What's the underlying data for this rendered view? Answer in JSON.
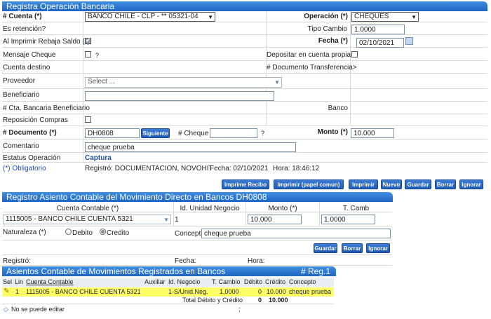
{
  "main_title": "Registra Operación Bancaria",
  "cuenta": {
    "label": "# Cuenta (*)",
    "value": "BANCO CHILE - CLP - ** 05321-04"
  },
  "operacion": {
    "label": "Operación (*)",
    "value": "CHEQUES"
  },
  "retencion": {
    "label": "Es retención?"
  },
  "tipo_cambio": {
    "label": "Tipo Cambio",
    "value": "1.0000"
  },
  "rebaja_saldo": {
    "label": "Al Imprimir Rebaja Saldo (*)"
  },
  "fecha": {
    "label": "Fecha (*)",
    "value": "02/10/2021"
  },
  "mensaje_cheque": {
    "label": "Mensaje Cheque",
    "help": "?"
  },
  "depositar": {
    "label": "Depositar en cuenta propia"
  },
  "cuenta_destino": {
    "label": "Cuenta destino"
  },
  "doc_transferencia": {
    "label": "# Documento Transferencia>"
  },
  "proveedor": {
    "label": "Proveedor",
    "placeholder": "Select ..."
  },
  "beneficiario": {
    "label": "Beneficiario"
  },
  "cta_bancaria": {
    "label": "# Cta. Bancaria Beneficiario"
  },
  "banco": {
    "label": "Banco"
  },
  "reposicion": {
    "label": "Reposición Compras"
  },
  "documento": {
    "label": "# Documento (*)",
    "value": "DH0808",
    "next": "Siguiente"
  },
  "cheque": {
    "label": "# Cheque",
    "help": "?"
  },
  "monto": {
    "label": "Monto (*)",
    "value": "10.000"
  },
  "comentario": {
    "label": "Comentario",
    "value": "cheque prueba"
  },
  "estatus": {
    "label": "Estatus Operación",
    "value": "Captura"
  },
  "footer": {
    "obligatorio": "(*) Obligatorio",
    "registro": "Registró: DOCUMENTACION, NOVOHIT",
    "fecha": "Fecha: 02/10/2021",
    "hora": "Hora: 18:46:12"
  },
  "toolbar": {
    "imprime_recibo": "Imprime Recibo",
    "imprimir_papel": "Imprimir (papel comun)",
    "imprimir": "Imprimir",
    "nuevo": "Nuevo",
    "guardar": "Guardar",
    "borrar": "Borrar",
    "ignorar": "Ignorar"
  },
  "asiento": {
    "title": "Registro Asiento Contable del Movimiento Directo en Bancos DH0808",
    "h_cuenta": "Cuenta Contable (*)",
    "h_unidad": "Id. Unidad Negocio",
    "h_monto": "Monto (*)",
    "h_tcamb": "T. Camb",
    "cuenta_value": "1115005 - BANCO CHILE CUENTA 5321",
    "unidad_value": "1",
    "monto_value": "10.000",
    "tcamb_value": "1.0000",
    "naturaleza_label": "Naturaleza (*)",
    "debito": "Debito",
    "credito": "Credito",
    "concepto_label": "Concepto",
    "concepto_value": "cheque prueba",
    "guardar": "Guardar",
    "borrar": "Borrar",
    "ignorar": "Ignorar",
    "registro": "Registró:",
    "fecha": "Fecha:",
    "hora": "Hora:"
  },
  "grid": {
    "title": "Asientos Contable de Movimientos Registrados en Bancos",
    "reg": "# Reg.1",
    "headers": [
      "Sel",
      "Lin",
      "Cuenta Contable",
      "Auxiliar",
      "Id. Negocio",
      "T. Cambio",
      "Débito",
      "Crédito",
      "Concepto"
    ],
    "row": {
      "lin": "1",
      "cuenta": "1115005 - BANCO CHILE CUENTA 5321",
      "negocio": "1-S/Unid.Neg.",
      "tcambio": "1,0000",
      "debito": "0",
      "credito": "10.000",
      "concepto": "cheque prueba"
    },
    "total_label": "Total Débito y Crédito",
    "total_debito": "0",
    "total_credito": "10.000",
    "semicolon": ";",
    "note": "No se puede editar"
  }
}
